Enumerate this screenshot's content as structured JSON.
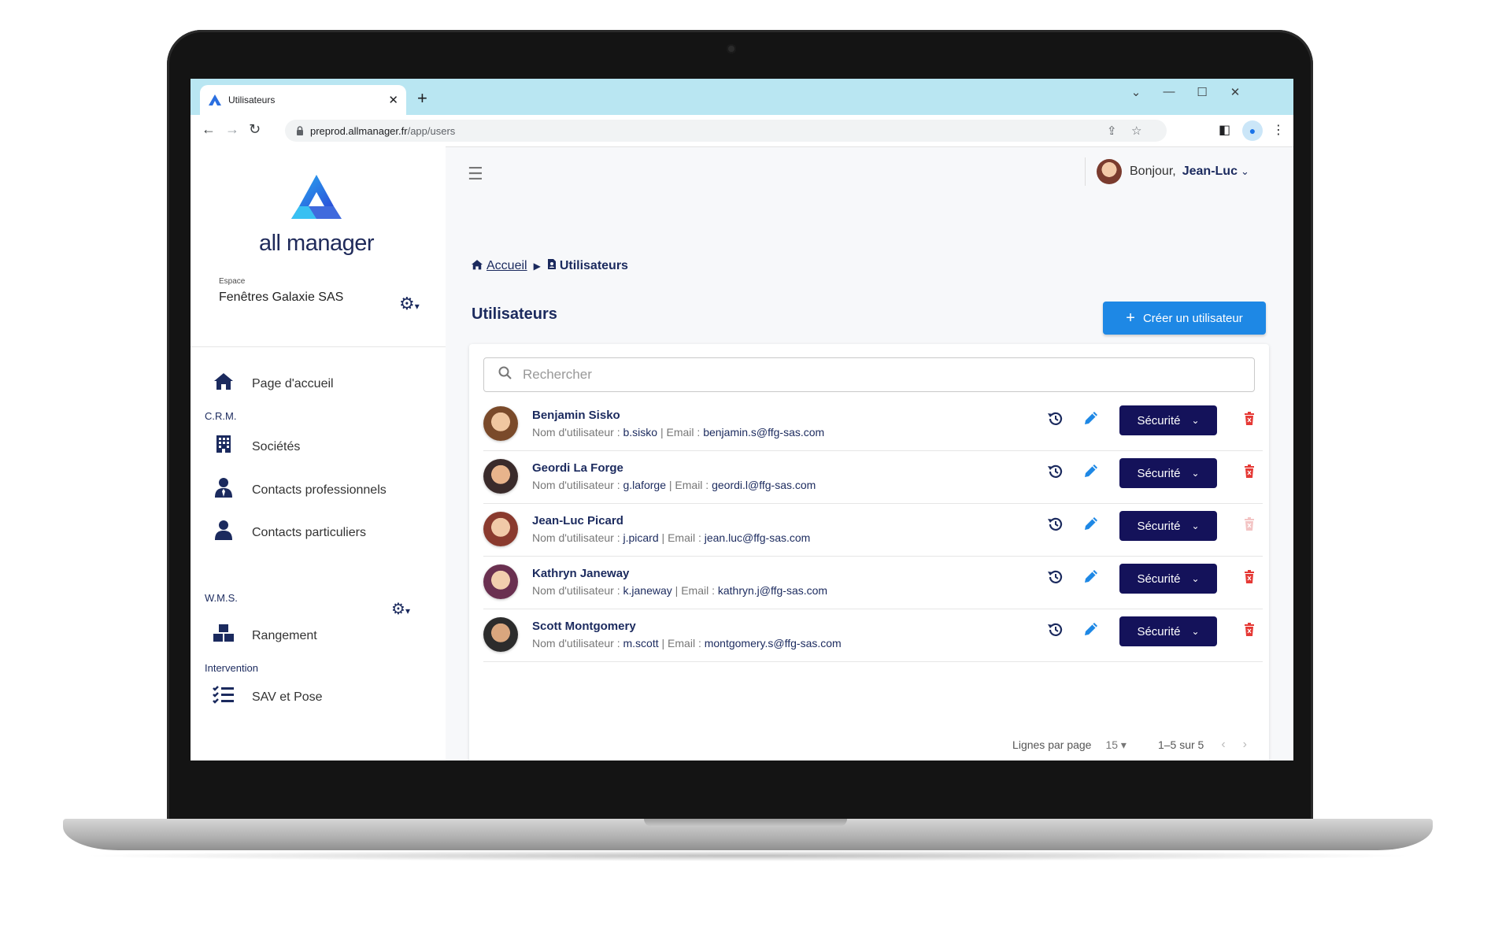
{
  "browser": {
    "tab_title": "Utilisateurs",
    "tab_close": "✕",
    "new_tab": "+",
    "url_host": "preprod.allmanager.fr",
    "url_path": "/app/users",
    "window_controls": [
      "⌄",
      "—",
      "☐",
      "✕"
    ]
  },
  "sidebar": {
    "logo_text": "all manager",
    "espace_label": "Espace",
    "espace_name": "Fenêtres Galaxie SAS",
    "items": [
      {
        "label": "Page d'accueil",
        "icon": "home-icon"
      },
      {
        "label": "Sociétés",
        "icon": "building-icon"
      },
      {
        "label": "Contacts professionnels",
        "icon": "user-tie-icon"
      },
      {
        "label": "Contacts particuliers",
        "icon": "user-icon"
      },
      {
        "label": "Rangement",
        "icon": "boxes-icon"
      },
      {
        "label": "SAV et Pose",
        "icon": "tasks-icon"
      }
    ],
    "sections": [
      "C.R.M.",
      "W.M.S.",
      "Intervention"
    ]
  },
  "header": {
    "greeting": "Bonjour,",
    "user_name": "Jean-Luc"
  },
  "breadcrumb": {
    "home": "Accueil",
    "current": "Utilisateurs"
  },
  "page": {
    "title": "Utilisateurs",
    "create_button": "Créer un utilisateur"
  },
  "search": {
    "placeholder": "Rechercher"
  },
  "users": [
    {
      "name": "Benjamin Sisko",
      "username": "b.sisko",
      "email": "benjamin.s@ffg-sas.com",
      "delete_enabled": true
    },
    {
      "name": "Geordi La Forge",
      "username": "g.laforge",
      "email": "geordi.l@ffg-sas.com",
      "delete_enabled": true
    },
    {
      "name": "Jean-Luc Picard",
      "username": "j.picard",
      "email": "jean.luc@ffg-sas.com",
      "delete_enabled": false
    },
    {
      "name": "Kathryn Janeway",
      "username": "k.janeway",
      "email": "kathryn.j@ffg-sas.com",
      "delete_enabled": true
    },
    {
      "name": "Scott Montgomery",
      "username": "m.scott",
      "email": "montgomery.s@ffg-sas.com",
      "delete_enabled": true
    }
  ],
  "row_labels": {
    "username_label": "Nom d'utilisateur :",
    "email_label": "Email :",
    "separator": "|",
    "security_button": "Sécurité"
  },
  "pagination": {
    "rows_per_page_label": "Lignes par page",
    "rows_per_page": "15",
    "range": "1–5 sur 5"
  },
  "colors": {
    "primary_navy": "#1b2a5e",
    "security_button": "#14125a",
    "create_button": "#1e88e5",
    "delete": "#e53935",
    "tabbar": "#b9e6f2"
  }
}
